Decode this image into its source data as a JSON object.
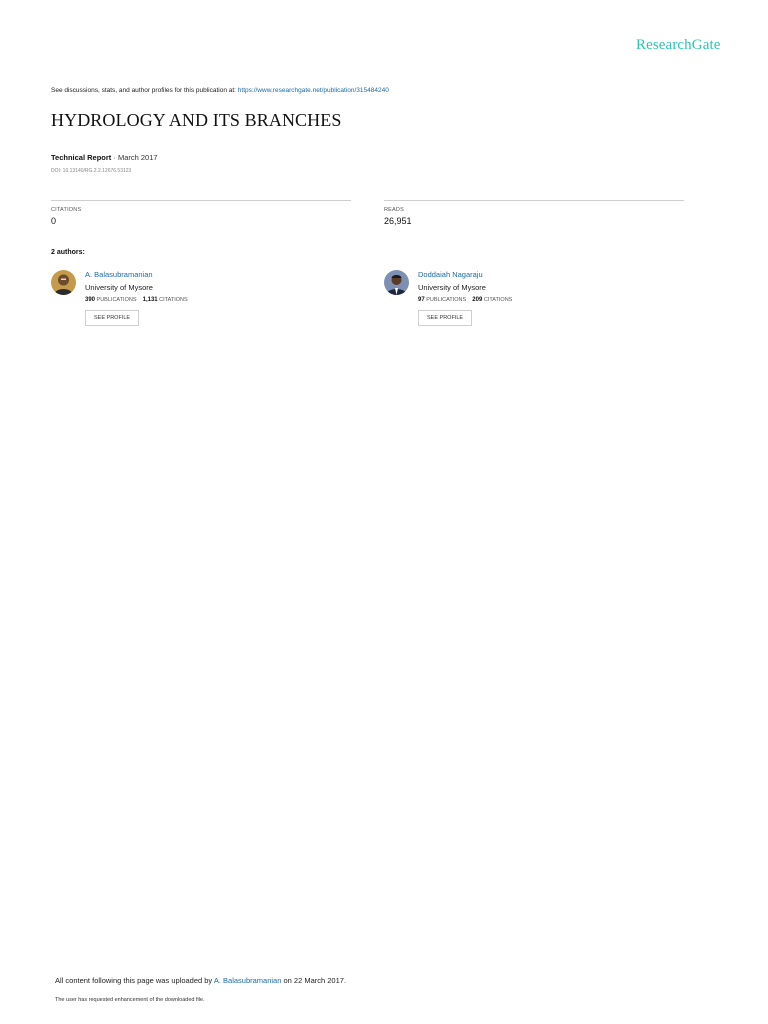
{
  "brand": "ResearchGate",
  "discussion": {
    "prefix": "See discussions, stats, and author profiles for this publication at: ",
    "url": "https://www.researchgate.net/publication/315484240"
  },
  "title": "HYDROLOGY AND ITS BRANCHES",
  "meta": {
    "type": "Technical Report",
    "separator": " · ",
    "date": "March 2017"
  },
  "doi": "DOI: 10.13140/RG.2.2.12676.53123",
  "stats": {
    "citations_label": "CITATIONS",
    "citations_value": "0",
    "reads_label": "READS",
    "reads_value": "26,951"
  },
  "authors_heading": "2 authors:",
  "authors": [
    {
      "name": "A. Balasubramanian",
      "institution": "University of Mysore",
      "publications": "390",
      "publications_label": "PUBLICATIONS",
      "citations": "1,131",
      "citations_label": "CITATIONS",
      "button": "SEE PROFILE"
    },
    {
      "name": "Doddaiah Nagaraju",
      "institution": "University of Mysore",
      "publications": "97",
      "publications_label": "PUBLICATIONS",
      "citations": "209",
      "citations_label": "CITATIONS",
      "button": "SEE PROFILE"
    }
  ],
  "footer": {
    "uploaded_prefix": "All content following this page was uploaded by ",
    "uploader": "A. Balasubramanian",
    "uploaded_suffix": " on 22 March 2017.",
    "note": "The user has requested enhancement of the downloaded file."
  },
  "colors": {
    "brand": "#2ac5b3",
    "link": "#1a6aa8"
  }
}
